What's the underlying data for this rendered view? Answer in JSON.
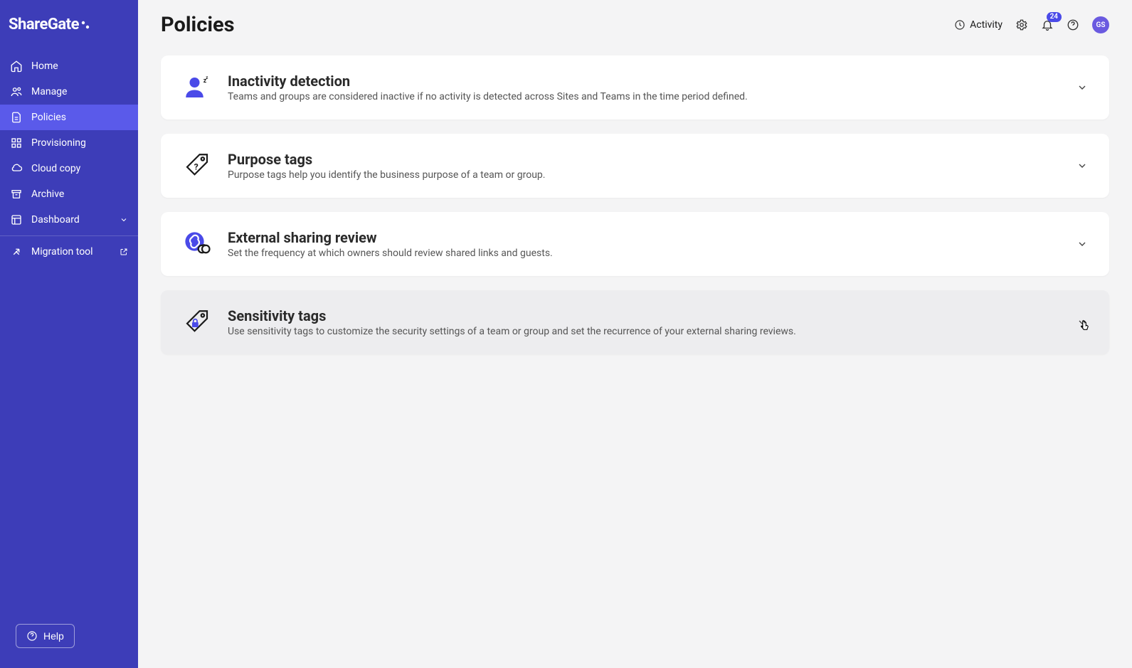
{
  "brand": "ShareGate",
  "sidebar": {
    "items": [
      {
        "label": "Home"
      },
      {
        "label": "Manage"
      },
      {
        "label": "Policies"
      },
      {
        "label": "Provisioning"
      },
      {
        "label": "Cloud copy"
      },
      {
        "label": "Archive"
      },
      {
        "label": "Dashboard"
      },
      {
        "label": "Migration tool"
      }
    ],
    "help": "Help"
  },
  "header": {
    "title": "Policies",
    "activity": "Activity",
    "notification_count": "24",
    "avatar_initials": "GS"
  },
  "policies": [
    {
      "title": "Inactivity detection",
      "desc": "Teams and groups are considered inactive if no activity is detected across Sites and Teams in the time period defined."
    },
    {
      "title": "Purpose tags",
      "desc": "Purpose tags help you identify the business purpose of a team or group."
    },
    {
      "title": "External sharing review",
      "desc": "Set the frequency at which owners should review shared links and guests."
    },
    {
      "title": "Sensitivity tags",
      "desc": "Use sensitivity tags to customize the security settings of a team or group and set the recurrence of your external sharing reviews."
    }
  ]
}
